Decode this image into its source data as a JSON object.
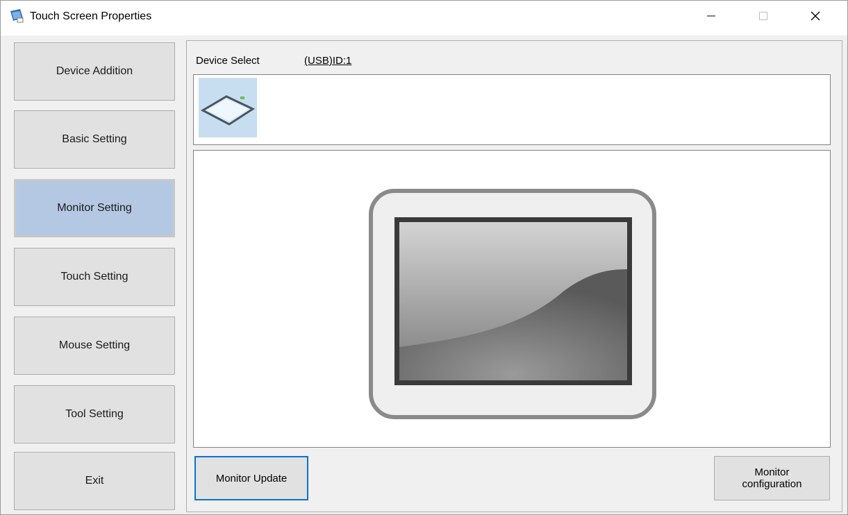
{
  "window": {
    "title": "Touch Screen Properties",
    "controls": {
      "minimize": "—",
      "maximize": "☐",
      "close": "✕"
    }
  },
  "sidebar": {
    "items": [
      {
        "label": "Device Addition",
        "active": false
      },
      {
        "label": "Basic Setting",
        "active": false
      },
      {
        "label": "Monitor Setting",
        "active": true
      },
      {
        "label": "Touch Setting",
        "active": false
      },
      {
        "label": "Mouse Setting",
        "active": false
      },
      {
        "label": "Tool Setting",
        "active": false
      },
      {
        "label": "Exit",
        "active": false
      }
    ]
  },
  "device_select": {
    "label": "Device Select",
    "value": "(USB)ID:1",
    "devices": [
      {
        "icon": "touch-panel-icon",
        "selected": true
      }
    ]
  },
  "monitor_view": {
    "icon": "monitor-icon"
  },
  "buttons": {
    "monitor_update": "Monitor Update",
    "monitor_configuration": "Monitor\nconfiguration"
  },
  "colors": {
    "active_nav": "#b5c8e3",
    "focus_border": "#0a72cc",
    "button_face": "#e1e1e1"
  }
}
